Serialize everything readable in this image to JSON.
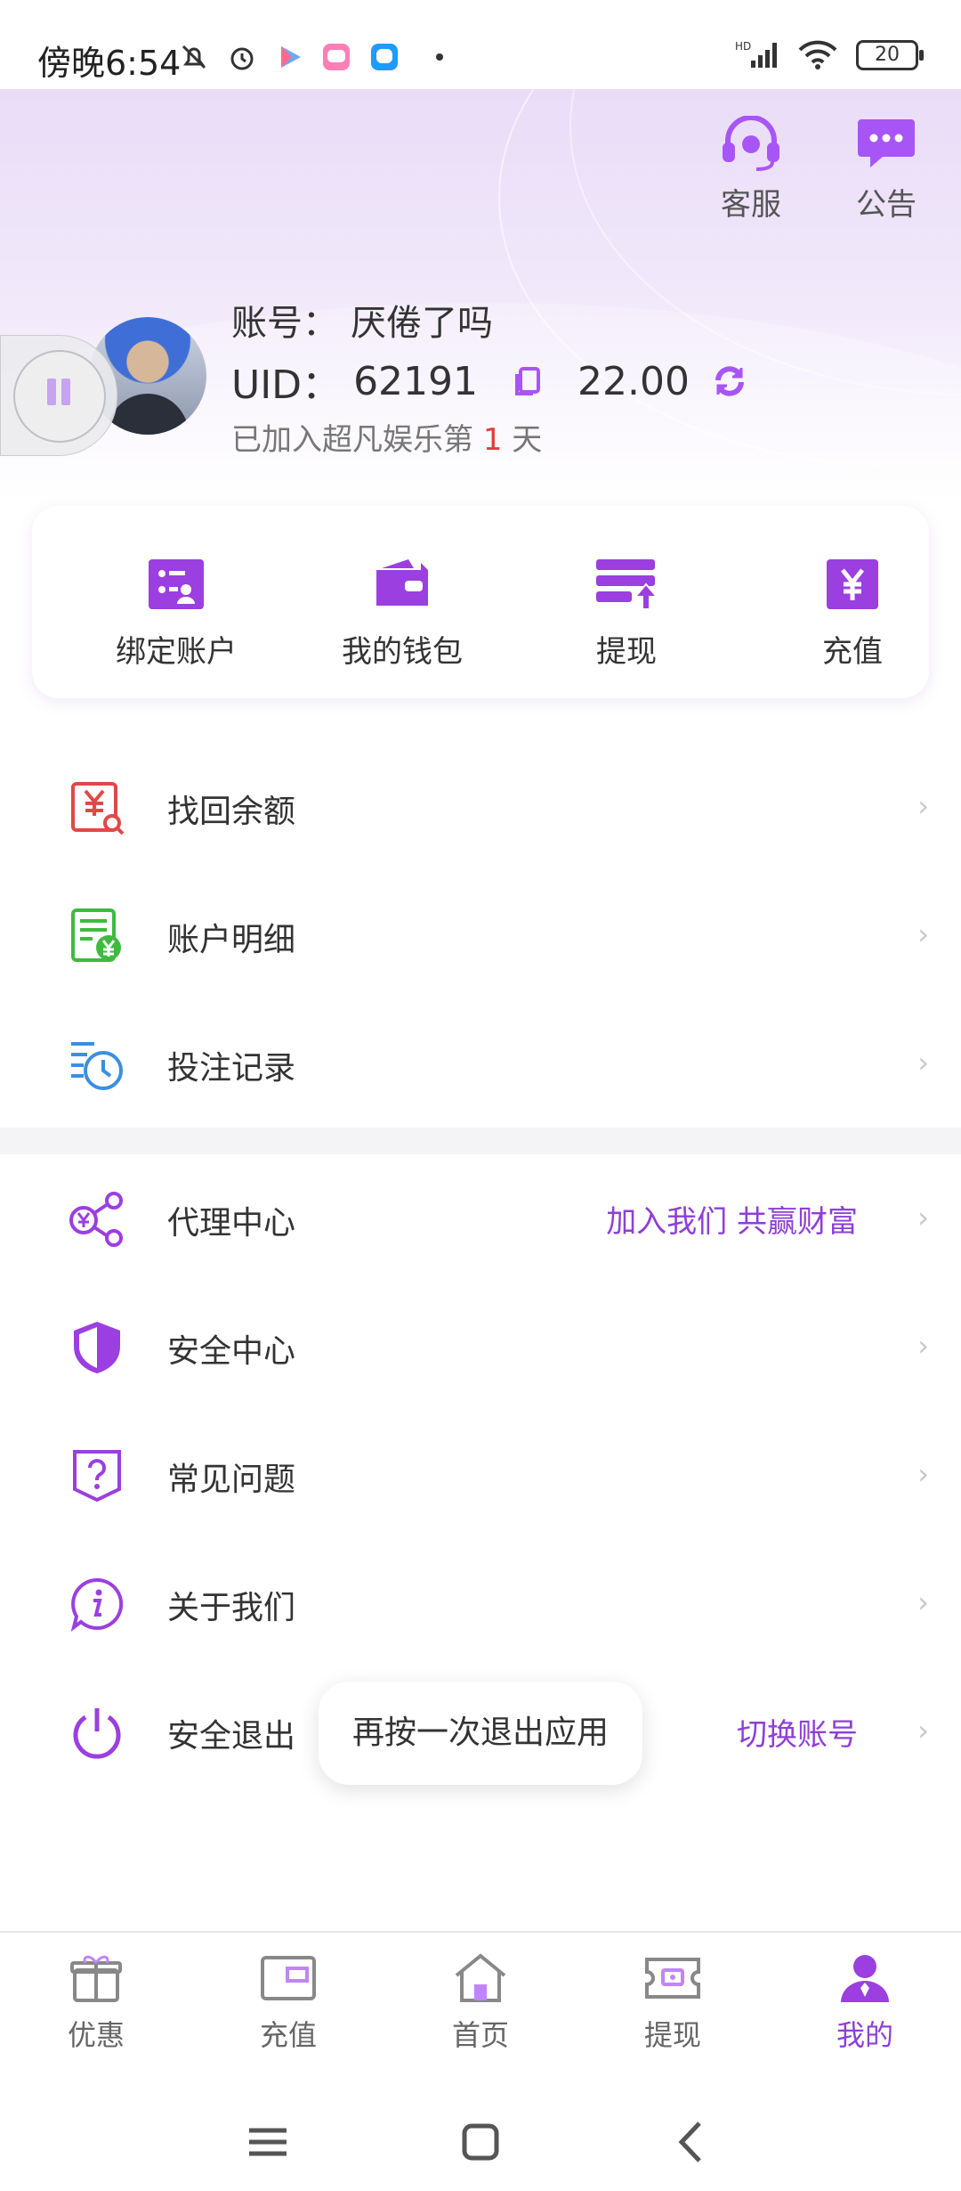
{
  "status_bar": {
    "time": "傍晚6:54",
    "signal_label": "HD",
    "battery": "20"
  },
  "header": {
    "service_label": "客服",
    "notice_label": "公告"
  },
  "profile": {
    "account_label": "账号：",
    "account_name": "厌倦了吗",
    "uid_label": "UID：",
    "uid_value": "62191",
    "balance": "22.00",
    "joined_prefix": "已加入超凡娱乐第",
    "joined_days": "1",
    "joined_suffix": "天"
  },
  "quick_actions": [
    {
      "label": "绑定账户",
      "icon": "bind-account-icon"
    },
    {
      "label": "我的钱包",
      "icon": "wallet-icon"
    },
    {
      "label": "提现",
      "icon": "withdraw-icon"
    },
    {
      "label": "充值",
      "icon": "recharge-icon"
    }
  ],
  "menu": {
    "recover_balance": "找回余额",
    "account_details": "账户明细",
    "bet_records": "投注记录",
    "agent_center": "代理中心",
    "agent_promo": "加入我们 共赢财富",
    "security_center": "安全中心",
    "faq": "常见问题",
    "about_us": "关于我们",
    "logout": "安全退出",
    "switch_account": "切换账号"
  },
  "toast": "再按一次退出应用",
  "tabs": [
    {
      "label": "优惠"
    },
    {
      "label": "充值"
    },
    {
      "label": "首页"
    },
    {
      "label": "提现"
    },
    {
      "label": "我的"
    }
  ],
  "colors": {
    "accent": "#8e3fd6",
    "accent_light": "#a855f7",
    "red": "#e23b3b",
    "green": "#3dbb3d",
    "blue": "#3b8fe0"
  }
}
